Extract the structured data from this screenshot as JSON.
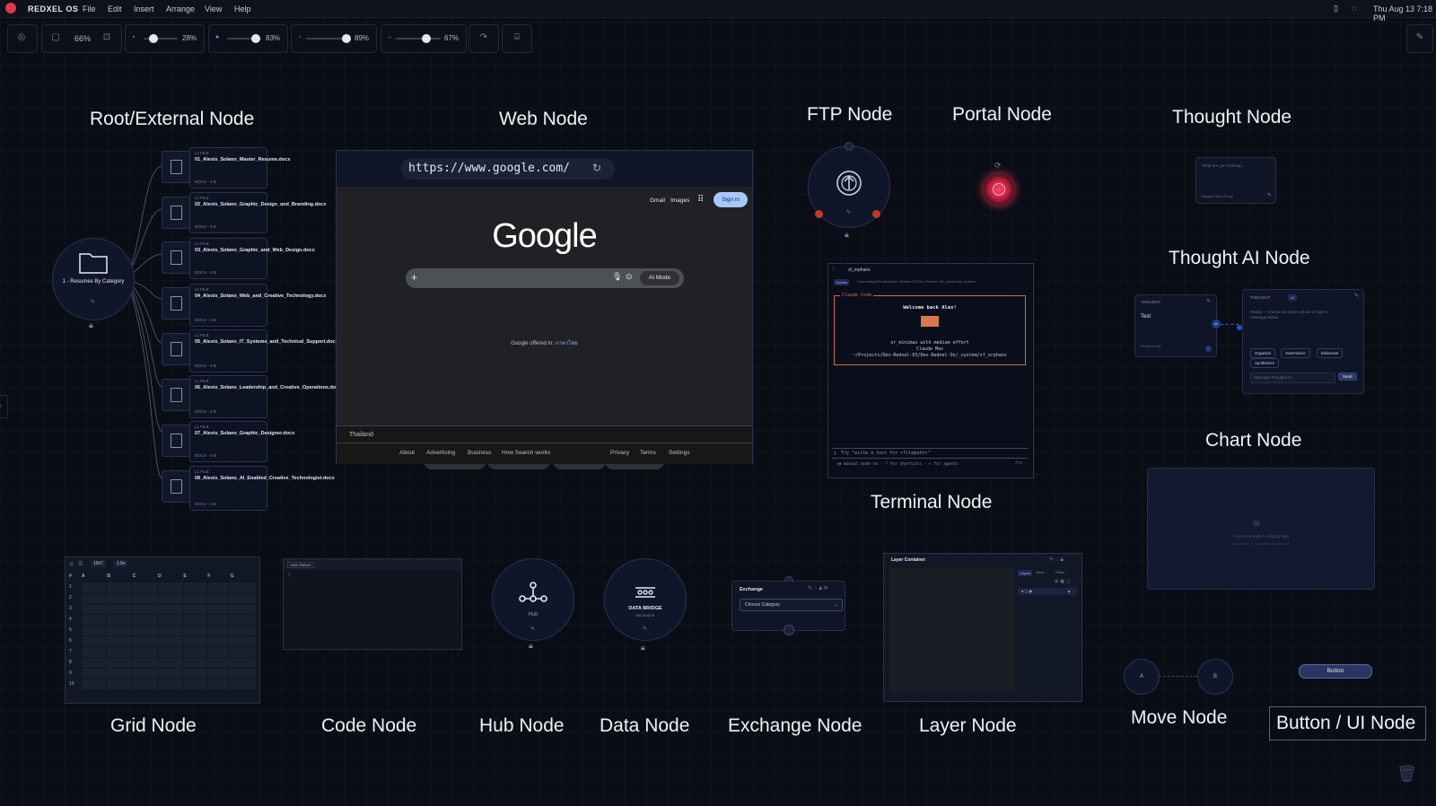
{
  "app": {
    "brand": "REDXEL OS",
    "menu": [
      "File",
      "Edit",
      "Insert",
      "Arrange",
      "View",
      "Help"
    ],
    "clock": "Thu Aug 13 7:18 PM"
  },
  "toolbar": {
    "zoom": "66%",
    "sliders": [
      {
        "pct": "28%",
        "level": 0.28
      },
      {
        "pct": "83%",
        "level": 0.83
      },
      {
        "pct": "89%",
        "level": 0.89
      },
      {
        "pct": "67%",
        "level": 0.67
      }
    ]
  },
  "titles": {
    "root": "Root/External Node",
    "web": "Web Node",
    "ftp": "FTP Node",
    "portal": "Portal Node",
    "thought": "Thought Node",
    "thought_ai": "Thought AI Node",
    "chart": "Chart Node",
    "terminal": "Terminal Node",
    "grid": "Grid Node",
    "code": "Code Node",
    "hub": "Hub Node",
    "data": "Data Node",
    "exchange": "Exchange Node",
    "layer": "Layer Node",
    "move": "Move Node",
    "button_ui": "Button / UI Node"
  },
  "root_node": {
    "label": "1 - Resumes By Category",
    "files": [
      {
        "tag": "L1 FILE",
        "name": "01_Alexis_Solano_Master_Resume.docx",
        "meta": "DOCX · 0 B"
      },
      {
        "tag": "L1 FILE",
        "name": "02_Alexis_Solano_Graphic_Design_and_Branding.docx",
        "meta": "DOCX · 0 B"
      },
      {
        "tag": "L1 FILE",
        "name": "03_Alexis_Solano_Graphic_and_Web_Design.docx",
        "meta": "DOCX · 0 B"
      },
      {
        "tag": "L1 FILE",
        "name": "04_Alexis_Solano_Web_and_Creative_Technology.docx",
        "meta": "DOCX · 0 B"
      },
      {
        "tag": "L1 FILE",
        "name": "05_Alexis_Solano_IT_Systems_and_Technical_Support.docx",
        "meta": "DOCX · 0 B"
      },
      {
        "tag": "L1 FILE",
        "name": "06_Alexis_Solano_Leadership_and_Creative_Operations.docx",
        "meta": "DOCX · 0 B"
      },
      {
        "tag": "L1 FILE",
        "name": "07_Alexis_Solano_Graphic_Designer.docx",
        "meta": "DOCX · 0 B"
      },
      {
        "tag": "L1 FILE",
        "name": "08_Alexis_Solano_AI_Enabled_Creative_Technologist.docx",
        "meta": "DOCX · 0 B"
      }
    ]
  },
  "web_node": {
    "url": "https://www.google.com/",
    "gmail": "Gmail",
    "images": "Images",
    "signin": "Sign in",
    "logo": "Google",
    "ai_mode": "AI Mode",
    "pills": [
      "Create images",
      "Ask about files",
      "Brainstorm",
      "I'm Feeling Lucky"
    ],
    "offered": "Google offered in:",
    "offered_lang": "ภาษาไทย",
    "country": "Thailand",
    "footer_left": [
      "About",
      "Advertising",
      "Business",
      "How Search works"
    ],
    "footer_right": [
      "Privacy",
      "Terms",
      "Settings"
    ]
  },
  "terminal_node": {
    "tab": "sf_orphans",
    "badge": "Orphan",
    "path": "/Users/alpha/Projects/Dev-Redxel-OS/Dev-Redxel-Os/_system/sf_orphans",
    "box_title": "Claude Code",
    "welcome": "Welcome back Alex!",
    "line1": "or_minimax with medium effort",
    "line2": "Claude Max",
    "line3": "~/Projects/Dev-Redxel-OS/Dev-Redxel-Os/_system/sf_orphans",
    "prompt": "Try \"write a test for <filepath>\"",
    "status": "⏵⏵ manual mode on · ? for shortcuts · ← for agents",
    "status_right": "/rc"
  },
  "thought_node": {
    "placeholder": "What are you thinking...",
    "assign": "Assign Color Group"
  },
  "thought_ai_node": {
    "label": "THOUGHT",
    "text": "Test",
    "time": "09:18:24 AM",
    "ai_label": "THOUGHT",
    "ai_badge": "AI",
    "ready": "Ready — choose an action above or type a message below",
    "actions": [
      "Organize",
      "Summarize",
      "Elaborate",
      "Synthesize"
    ],
    "input": "Message Thought AI...",
    "send": "Send"
  },
  "chart_node": {
    "empty1": "Connect a node to display data",
    "empty2": "Right-click → Connect Data Source"
  },
  "grid_node": {
    "size": "10x7",
    "zoom": "1.5x",
    "cols": [
      "#",
      "A",
      "B",
      "C",
      "D",
      "E",
      "F",
      "G"
    ],
    "rows": [
      "1",
      "2",
      "3",
      "4",
      "5",
      "6",
      "7",
      "8",
      "9",
      "10"
    ]
  },
  "code_node": {
    "lang": "Auto Detect",
    "line": "1"
  },
  "hub_node": {
    "label": "Hub"
  },
  "data_node": {
    "label": "DATA BRIDGE",
    "sub": "No source"
  },
  "exchange_node": {
    "title": "Exchange",
    "select": "Choose Category"
  },
  "layer_node": {
    "title": "Layer Container",
    "tabs": [
      "Layers",
      "Elem...",
      "Paths"
    ]
  },
  "move_node": {
    "a": "A",
    "b": "B"
  },
  "button_node": {
    "label": "Button"
  }
}
